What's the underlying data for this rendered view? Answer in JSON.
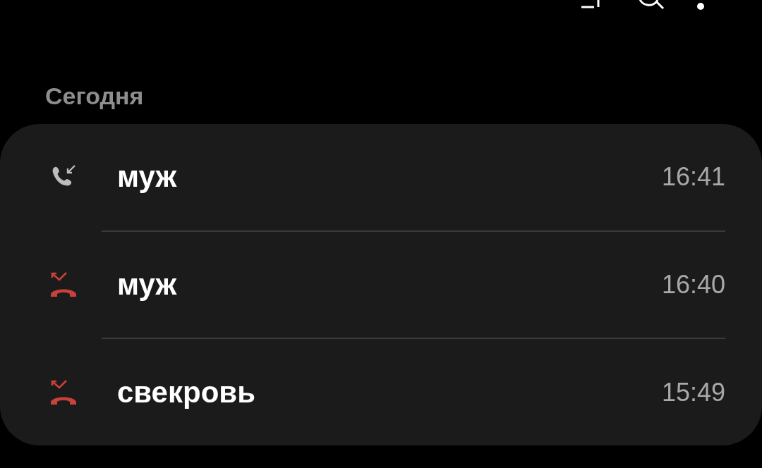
{
  "section": {
    "title": "Сегодня"
  },
  "calls": [
    {
      "kind": "incoming",
      "name": "муж",
      "time": "16:41"
    },
    {
      "kind": "missed",
      "name": "муж",
      "time": "16:40"
    },
    {
      "kind": "missed",
      "name": "свекровь",
      "time": "15:49"
    }
  ]
}
